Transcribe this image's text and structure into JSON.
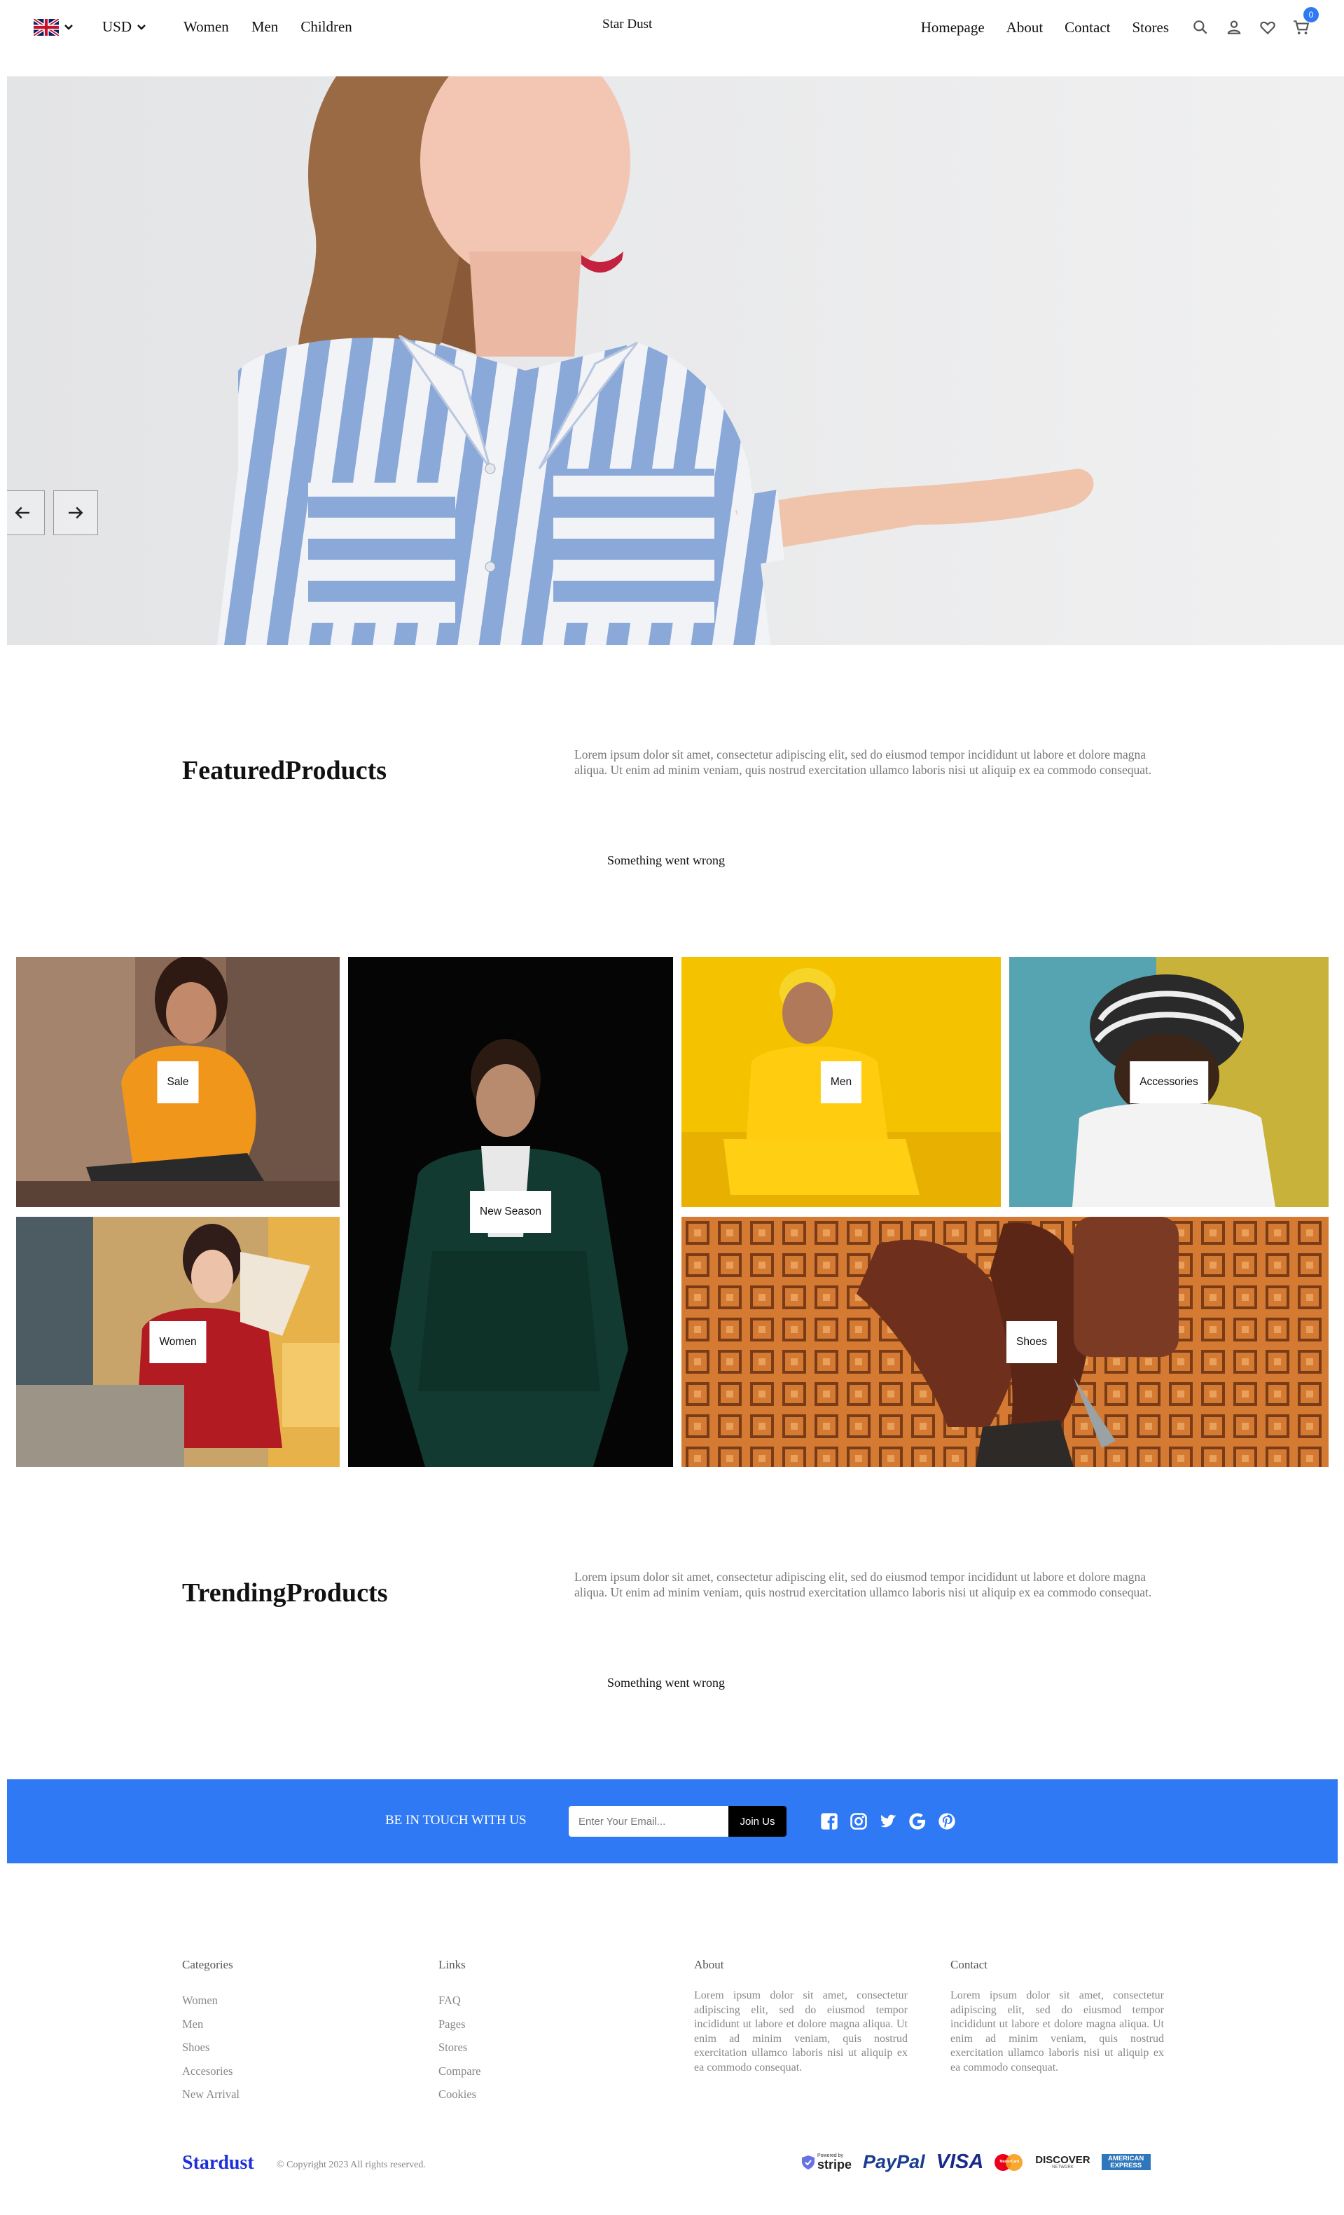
{
  "header": {
    "brand": "Star Dust",
    "currency": "USD",
    "left_links": [
      "Women",
      "Men",
      "Children"
    ],
    "right_links": [
      "Homepage",
      "About",
      "Contact",
      "Stores"
    ],
    "cart_count": "0",
    "icons": [
      "uk-flag-icon",
      "chevron-down-icon",
      "search-icon",
      "user-icon",
      "heart-icon",
      "cart-icon"
    ]
  },
  "hero": {
    "prev_icon": "arrow-left-icon",
    "next_icon": "arrow-right-icon"
  },
  "featured": {
    "title": "FeaturedProducts",
    "description": "Lorem ipsum dolor sit amet, consectetur adipiscing elit, sed do eiusmod tempor incididunt ut labore et dolore magna aliqua. Ut enim ad minim veniam, quis nostrud exercitation ullamco laboris nisi ut aliquip ex ea commodo consequat.",
    "status": "Something went wrong"
  },
  "categories": {
    "sale": "Sale",
    "women": "Women",
    "new_season": "New Season",
    "men": "Men",
    "accessories": "Accessories",
    "shoes": "Shoes"
  },
  "trending": {
    "title": "TrendingProducts",
    "description": "Lorem ipsum dolor sit amet, consectetur adipiscing elit, sed do eiusmod tempor incididunt ut labore et dolore magna aliqua. Ut enim ad minim veniam, quis nostrud exercitation ullamco laboris nisi ut aliquip ex ea commodo consequat.",
    "status": "Something went wrong"
  },
  "newsletter": {
    "text": "BE IN TOUCH WITH US",
    "placeholder": "Enter Your Email...",
    "button": "Join Us",
    "socials": [
      "facebook-icon",
      "instagram-icon",
      "twitter-icon",
      "google-icon",
      "pinterest-icon"
    ]
  },
  "footer": {
    "categories": {
      "title": "Categories",
      "items": [
        "Women",
        "Men",
        "Shoes",
        "Accesories",
        "New Arrival"
      ]
    },
    "links": {
      "title": "Links",
      "items": [
        "FAQ",
        "Pages",
        "Stores",
        "Compare",
        "Cookies"
      ]
    },
    "about": {
      "title": "About",
      "text": "Lorem ipsum dolor sit amet, consectetur adipiscing elit, sed do eiusmod tempor incididunt ut labore et dolore magna aliqua. Ut enim ad minim veniam, quis nostrud exercitation ullamco laboris nisi ut aliquip ex ea commodo consequat."
    },
    "contact": {
      "title": "Contact",
      "text": "Lorem ipsum dolor sit amet, consectetur adipiscing elit, sed do eiusmod tempor incididunt ut labore et dolore magna aliqua. Ut enim ad minim veniam, quis nostrud exercitation ullamco laboris nisi ut aliquip ex ea commodo consequat."
    },
    "brand": "Stardust",
    "copyright": "© Copyright 2023 All rights reserved.",
    "payments": {
      "stripe_top": "Powered by",
      "stripe": "stripe",
      "paypal": "PayPal",
      "visa": "VISA",
      "mastercard": "MasterCard",
      "discover": "DISCOVER",
      "discover_sub": "NETWORK",
      "amex": "AMERICAN EXPRESS"
    }
  },
  "colors": {
    "accent": "#2f79f5",
    "brand_footer": "#1f2fd8"
  }
}
